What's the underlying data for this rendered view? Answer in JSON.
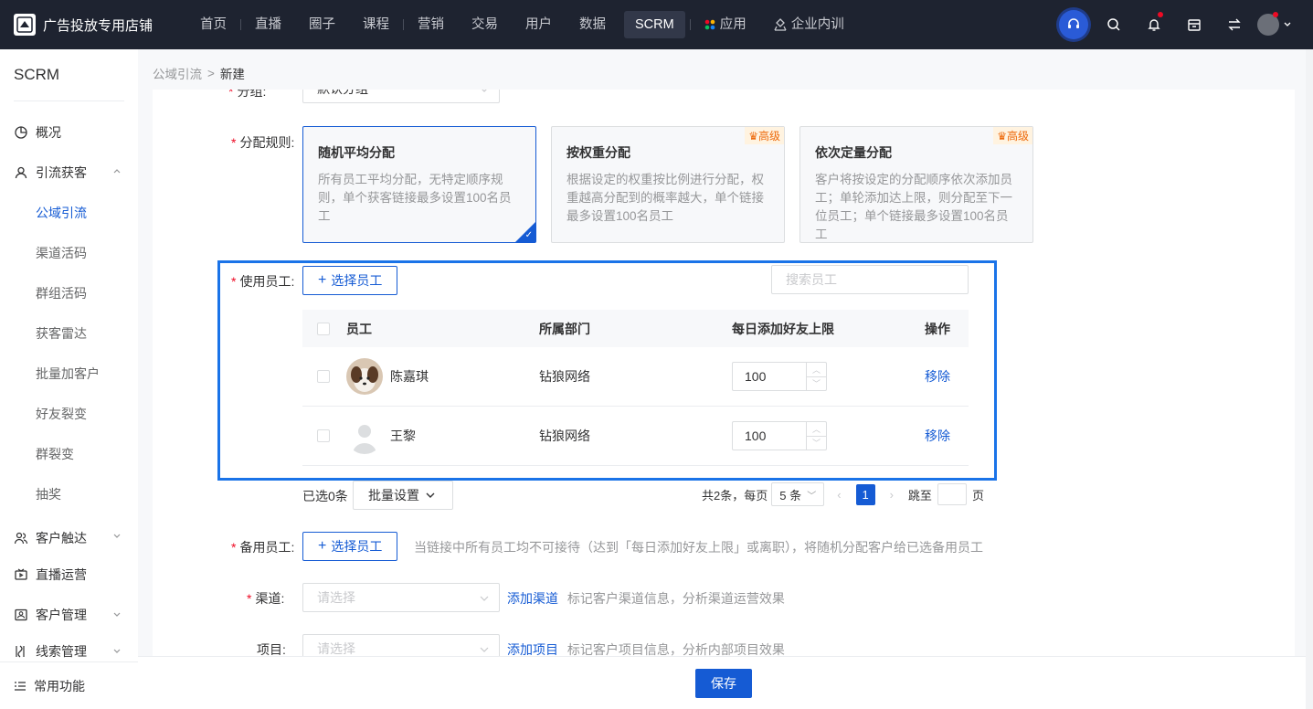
{
  "header": {
    "shop_name": "广告投放专用店铺",
    "logo_text": "SCRM",
    "nav": [
      "首页",
      "直播",
      "圈子",
      "课程",
      "营销",
      "交易",
      "用户",
      "数据",
      "SCRM",
      "应用",
      "企业内训"
    ],
    "active_nav": "SCRM"
  },
  "sidebar": {
    "title": "SCRM",
    "overview": "概况",
    "lead_group": "引流获客",
    "lead_items": [
      "公域引流",
      "渠道活码",
      "群组活码",
      "获客雷达",
      "批量加客户",
      "好友裂变",
      "群裂变",
      "抽奖"
    ],
    "active_item": "公域引流",
    "reach": "客户触达",
    "live_ops": "直播运营",
    "customer_mgmt": "客户管理",
    "lead_mgmt": "线索管理",
    "common": "常用功能"
  },
  "breadcrumb": {
    "parent": "公域引流",
    "current": "新建"
  },
  "form": {
    "group_label": "分组:",
    "group_value": "默认分组",
    "rule_label": "分配规则:",
    "rules": [
      {
        "title": "随机平均分配",
        "desc": "所有员工平均分配，无特定顺序规则，单个获客链接最多设置100名员工",
        "badge": ""
      },
      {
        "title": "按权重分配",
        "desc": "根据设定的权重按比例进行分配，权重越高分配到的概率越大，单个链接最多设置100名员工",
        "badge": "高级"
      },
      {
        "title": "依次定量分配",
        "desc": "客户将按设定的分配顺序依次添加员工；单轮添加达上限，则分配至下一位员工；单个链接最多设置100名员工",
        "badge": "高级"
      }
    ],
    "staff_label": "使用员工:",
    "select_staff_btn": "选择员工",
    "search_placeholder": "搜索员工",
    "table": {
      "headers": [
        "员工",
        "所属部门",
        "每日添加好友上限",
        "操作"
      ],
      "rows": [
        {
          "name": "陈嘉琪",
          "dept": "钻狼网络",
          "limit": "100",
          "action": "移除"
        },
        {
          "name": "王黎",
          "dept": "钻狼网络",
          "limit": "100",
          "action": "移除"
        }
      ]
    },
    "selected_count": "已选0条",
    "batch_btn": "批量设置",
    "pager": {
      "total": "共2条，每页",
      "page_size": "5 条",
      "page": "1",
      "jump_to": "跳至",
      "page_unit": "页"
    },
    "backup_label": "备用员工:",
    "backup_btn": "选择员工",
    "backup_hint": "当链接中所有员工均不可接待（达到「每日添加好友上限」或离职），将随机分配客户给已选备用员工",
    "channel_label": "渠道:",
    "channel_placeholder": "请选择",
    "channel_link": "添加渠道",
    "channel_hint": "标记客户渠道信息，分析渠道运营效果",
    "project_label": "项目:",
    "project_placeholder": "请选择",
    "project_link": "添加项目",
    "project_hint": "标记客户项目信息，分析内部项目效果"
  },
  "footer": {
    "save": "保存"
  },
  "colors": {
    "primary": "#155bd4",
    "topbar": "#1e2330",
    "required": "#ee0a24",
    "highlight": "#1a73e8"
  }
}
